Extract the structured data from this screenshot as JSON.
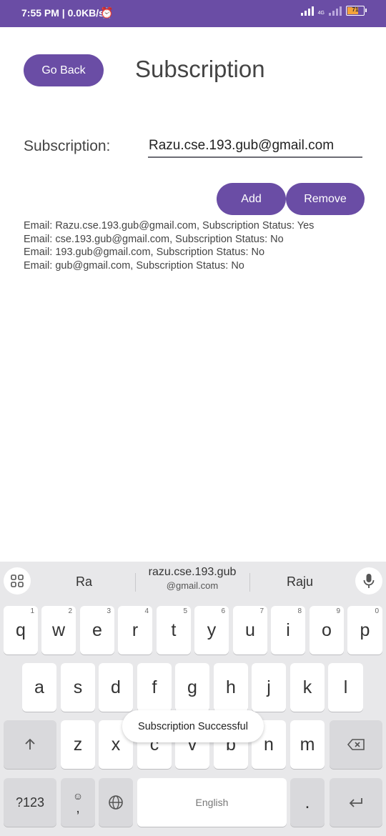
{
  "status_bar": {
    "time_speed": "7:55 PM | 0.0KB/s",
    "alarm_icon": "alarm-clock-icon",
    "network": "4G",
    "battery_level": "71",
    "color": "#6a4da5"
  },
  "header": {
    "back_label": "Go Back",
    "title": "Subscription"
  },
  "form": {
    "label": "Subscription:",
    "email_value": "Razu.cse.193.gub@gmail.com",
    "add_label": "Add",
    "remove_label": "Remove"
  },
  "list": [
    "Email: Razu.cse.193.gub@gmail.com, Subscription Status: Yes",
    "Email: cse.193.gub@gmail.com, Subscription Status: No",
    "Email: 193.gub@gmail.com, Subscription Status: No",
    "Email: gub@gmail.com, Subscription Status: No"
  ],
  "keyboard": {
    "suggestions": {
      "left": "Ra",
      "middle_line1": "razu.cse.193.gub",
      "middle_line2": "@gmail.com",
      "right": "Raju"
    },
    "row1": [
      {
        "k": "q",
        "n": "1"
      },
      {
        "k": "w",
        "n": "2"
      },
      {
        "k": "e",
        "n": "3"
      },
      {
        "k": "r",
        "n": "4"
      },
      {
        "k": "t",
        "n": "5"
      },
      {
        "k": "y",
        "n": "6"
      },
      {
        "k": "u",
        "n": "7"
      },
      {
        "k": "i",
        "n": "8"
      },
      {
        "k": "o",
        "n": "9"
      },
      {
        "k": "p",
        "n": "0"
      }
    ],
    "row2": [
      "a",
      "s",
      "d",
      "f",
      "g",
      "h",
      "j",
      "k",
      "l"
    ],
    "row3": [
      "z",
      "x",
      "c",
      "v",
      "b",
      "n",
      "m"
    ],
    "sym_label": "?123",
    "comma": ",",
    "space_label": "English",
    "period": ".",
    "shift_icon": "shift-arrow-icon",
    "backspace_icon": "backspace-icon",
    "enter_icon": "enter-icon",
    "globe_icon": "globe-icon",
    "emoji_icon": "emoji-icon"
  },
  "toast": "Subscription Successful",
  "accent": "#6a4da5"
}
